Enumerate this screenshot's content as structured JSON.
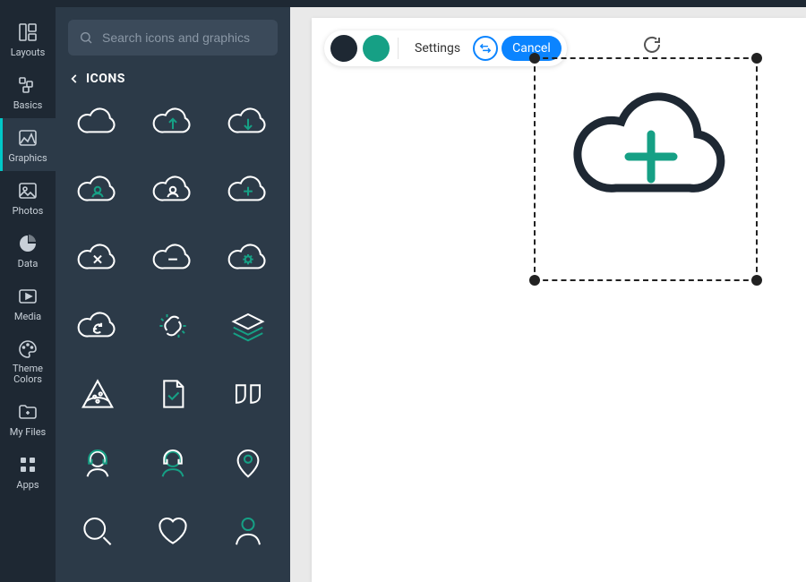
{
  "nav": {
    "items": [
      {
        "id": "layouts",
        "label": "Layouts"
      },
      {
        "id": "basics",
        "label": "Basics"
      },
      {
        "id": "graphics",
        "label": "Graphics"
      },
      {
        "id": "photos",
        "label": "Photos"
      },
      {
        "id": "data",
        "label": "Data"
      },
      {
        "id": "media",
        "label": "Media"
      },
      {
        "id": "theme",
        "label": "Theme Colors"
      },
      {
        "id": "myfiles",
        "label": "My Files"
      },
      {
        "id": "apps",
        "label": "Apps"
      }
    ],
    "active": "graphics"
  },
  "panel": {
    "search_placeholder": "Search icons and graphics",
    "title": "ICONS",
    "icons": [
      "cloud",
      "cloud-upload",
      "cloud-download",
      "cloud-user",
      "cloud-user-alt",
      "cloud-plus",
      "cloud-x",
      "cloud-minus",
      "cloud-gear",
      "cloud-sync",
      "link-break",
      "layers",
      "pizza",
      "file-check",
      "quote",
      "headset-user",
      "headset-user-alt",
      "map-pin",
      "search",
      "heart",
      "user"
    ]
  },
  "toolbar": {
    "colors": [
      "#1e2833",
      "#16a085"
    ],
    "settings_label": "Settings",
    "cancel_label": "Cancel"
  },
  "selected_element": {
    "icon": "cloud-plus",
    "stroke": "#1e2833",
    "accent": "#16a085"
  }
}
